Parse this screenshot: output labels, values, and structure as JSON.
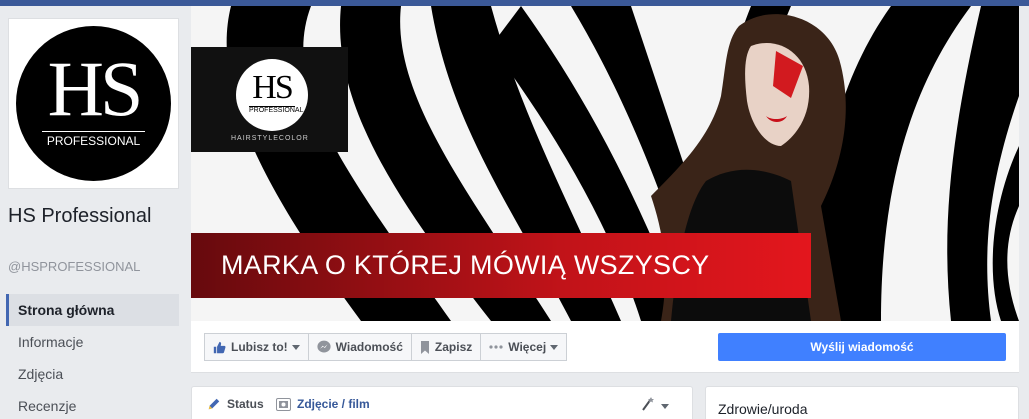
{
  "profile": {
    "logo_main": "HS",
    "logo_sub": "PROFESSIONAL",
    "name": "HS Professional",
    "handle": "@HSPROFESSIONAL"
  },
  "nav": {
    "items": [
      {
        "label": "Strona główna",
        "active": true
      },
      {
        "label": "Informacje"
      },
      {
        "label": "Zdjęcia"
      },
      {
        "label": "Recenzje"
      }
    ]
  },
  "cover": {
    "brand_main": "HS",
    "brand_sub": "PROFESSIONAL",
    "brand_tagline": "HAIRSTYLECOLOR",
    "banner_text": "MARKA O KTÓREJ MÓWIĄ WSZYSCY"
  },
  "actions": {
    "like": "Lubisz to!",
    "message": "Wiadomość",
    "save": "Zapisz",
    "more": "Więcej",
    "send_message": "Wyślij wiadomość"
  },
  "composer": {
    "status": "Status",
    "photo": "Zdjęcie / film"
  },
  "sidebar_box": {
    "category": "Zdrowie/uroda"
  },
  "colors": {
    "facebook_blue": "#3b5998",
    "button_blue": "#4080ff",
    "banner_red": "#e3161d"
  }
}
